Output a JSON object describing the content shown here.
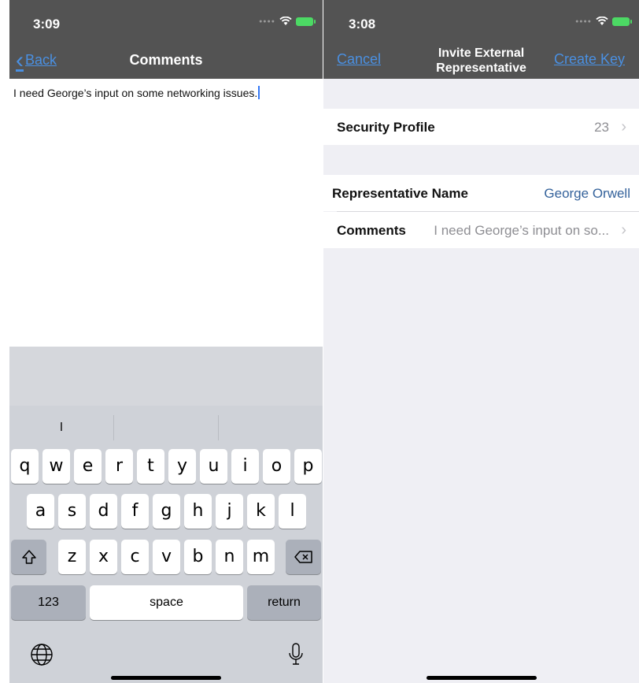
{
  "left": {
    "status": {
      "time": "3:09"
    },
    "nav": {
      "back_label": "Back",
      "title": "Comments"
    },
    "comment_text": "I need George’s input on some networking issues.",
    "keyboard": {
      "suggestions": [
        "I",
        "",
        ""
      ],
      "row1": [
        "q",
        "w",
        "e",
        "r",
        "t",
        "y",
        "u",
        "i",
        "o",
        "p"
      ],
      "row2": [
        "a",
        "s",
        "d",
        "f",
        "g",
        "h",
        "j",
        "k",
        "l"
      ],
      "row3": [
        "z",
        "x",
        "c",
        "v",
        "b",
        "n",
        "m"
      ],
      "numbers_label": "123",
      "space_label": "space",
      "return_label": "return"
    }
  },
  "right": {
    "status": {
      "time": "3:08"
    },
    "nav": {
      "cancel_label": "Cancel",
      "title_line1": "Invite External",
      "title_line2": "Representative",
      "create_label": "Create Key"
    },
    "security_profile": {
      "label": "Security Profile",
      "value": "23"
    },
    "representative": {
      "label": "Representative Name",
      "value": "George Orwell"
    },
    "comments": {
      "label": "Comments",
      "value": "I need George’s input on so..."
    }
  },
  "icons": [
    "back-chevron-icon",
    "wifi-icon",
    "battery-charging-icon",
    "shift-icon",
    "delete-icon",
    "globe-icon",
    "microphone-icon",
    "chevron-right-icon"
  ],
  "colors": {
    "nav_background": "#535353",
    "link": "#4a90e2",
    "value_blue": "#34629b",
    "keyboard_background": "#cfd2d8"
  }
}
